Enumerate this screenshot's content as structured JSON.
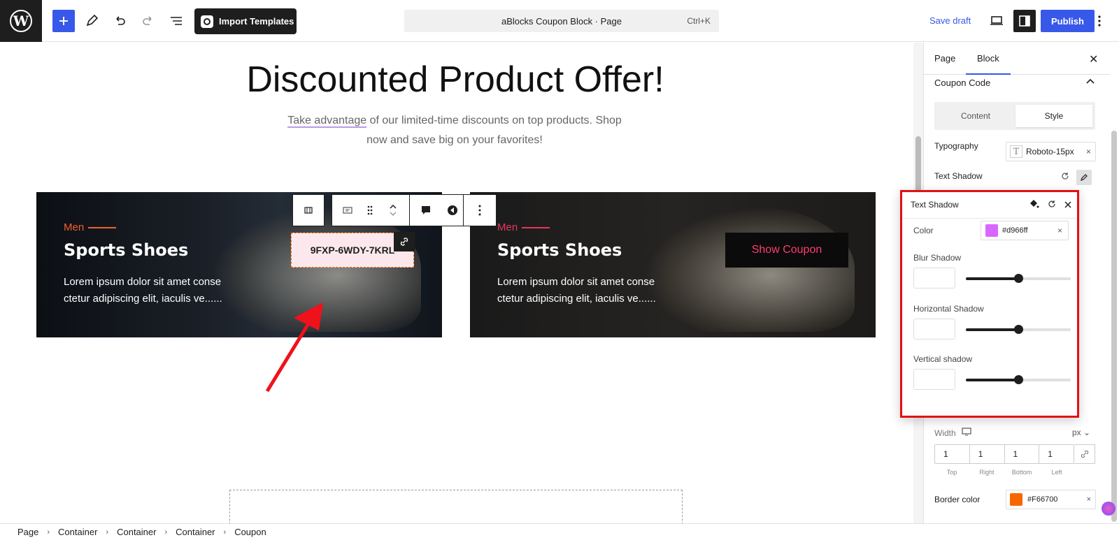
{
  "topbar": {
    "import_label": "Import Templates",
    "command_title": "aBlocks Coupon Block · Page",
    "shortcut": "Ctrl+K",
    "save_draft": "Save draft",
    "publish": "Publish"
  },
  "content": {
    "heading": "Discounted Product Offer!",
    "lead_underlined": "Take advantage",
    "lead_rest": " of our limited-time discounts on top products. Shop now and save big on your favorites!",
    "cards": [
      {
        "category": "Men",
        "title": "Sports Shoes",
        "desc": "Lorem ipsum dolor sit amet conse ctetur adipiscing elit, iaculis ve......",
        "coupon": "9FXP-6WDY-7KRL"
      },
      {
        "category": "Men",
        "title": "Sports Shoes",
        "desc": "Lorem ipsum dolor sit amet conse ctetur adipiscing elit, iaculis ve......",
        "coupon_button": "Show Coupon"
      }
    ]
  },
  "sidebar": {
    "tabs": [
      "Page",
      "Block"
    ],
    "section_title": "Coupon Code",
    "seg": [
      "Content",
      "Style"
    ],
    "typography_label": "Typography",
    "typography_value": "Roboto-15px",
    "text_shadow_label": "Text Shadow",
    "width_label": "Width",
    "unit": "px",
    "dims": {
      "values": [
        "1",
        "1",
        "1",
        "1"
      ],
      "labels": [
        "Top",
        "Right",
        "Bottom",
        "Left"
      ]
    },
    "border_color_label": "Border color",
    "border_color_value": "#F66700"
  },
  "popover": {
    "title": "Text Shadow",
    "color_label": "Color",
    "color_value": "#d966ff",
    "blur_label": "Blur Shadow",
    "horizontal_label": "Horizontal Shadow",
    "vertical_label": "Vertical shadow",
    "blur_level": 0.5,
    "horizontal_level": 0.5,
    "vertical_level": 0.5
  },
  "breadcrumb": [
    "Page",
    "Container",
    "Container",
    "Container",
    "Coupon"
  ],
  "colors": {
    "accent": "#3858e9",
    "highlight_border": "#e40f15",
    "shadow_color": "#d966ff",
    "border_color": "#F66700"
  }
}
